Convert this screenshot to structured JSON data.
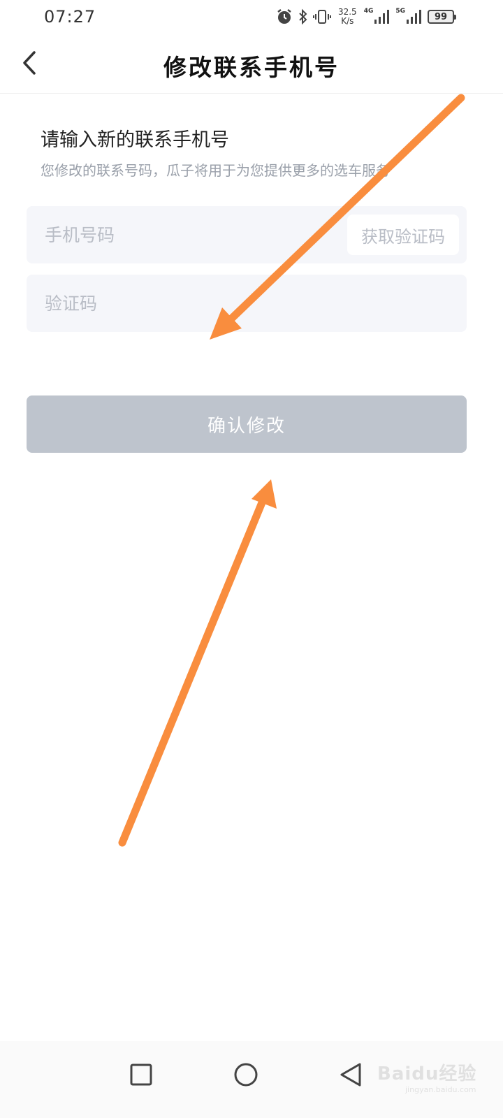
{
  "status_bar": {
    "time": "07:27",
    "speed_value": "32.5",
    "speed_unit": "K/s",
    "network_1": "4G",
    "network_2": "5G",
    "battery": "99",
    "icons": [
      "alarm-icon",
      "bluetooth-icon",
      "vibrate-icon",
      "signal-icon",
      "battery-icon"
    ]
  },
  "nav": {
    "title": "修改联系手机号",
    "back_icon": "chevron-left-icon"
  },
  "form": {
    "heading": "请输入新的联系手机号",
    "subtext": "您修改的联系号码，瓜子将用于为您提供更多的选车服务",
    "phone_placeholder": "手机号码",
    "get_code_label": "获取验证码",
    "code_placeholder": "验证码",
    "confirm_label": "确认修改"
  },
  "system_nav": {
    "recent_icon": "square-icon",
    "home_icon": "circle-icon",
    "back_icon": "triangle-back-icon"
  },
  "watermark": {
    "main": "Baidu经验",
    "sub": "jingyan.baidu.com"
  },
  "colors": {
    "arrow": "#f98d3e",
    "button_disabled": "#bec4cd",
    "field_bg": "#f5f6fa",
    "placeholder": "#b9bdc6"
  }
}
